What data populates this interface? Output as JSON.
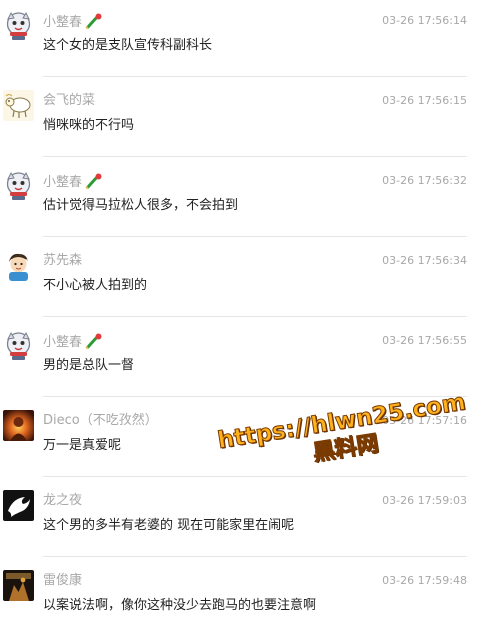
{
  "comments": [
    {
      "nick": "小整春",
      "has_badge": true,
      "avatar_icon": "cartoon-cat-avatar",
      "time": "03-26 17:56:14",
      "text": "这个女的是支队宣传科副科长"
    },
    {
      "nick": "会飞的菜",
      "has_badge": false,
      "avatar_icon": "sheep-doodle-avatar",
      "time": "03-26 17:56:15",
      "text": "悄咪咪的不行吗"
    },
    {
      "nick": "小整春",
      "has_badge": true,
      "avatar_icon": "cartoon-cat-avatar",
      "time": "03-26 17:56:32",
      "text": "估计觉得马拉松人很多，不会拍到"
    },
    {
      "nick": "苏先森",
      "has_badge": false,
      "avatar_icon": "cartoon-boy-avatar",
      "time": "03-26 17:56:34",
      "text": "不小心被人拍到的"
    },
    {
      "nick": "小整春",
      "has_badge": true,
      "avatar_icon": "cartoon-cat-avatar",
      "time": "03-26 17:56:55",
      "text": "男的是总队一督"
    },
    {
      "nick": "Dieco（不吃孜然）",
      "has_badge": false,
      "avatar_icon": "photo-avatar",
      "time": "03-26 17:57:16",
      "text": "万一是真爱呢"
    },
    {
      "nick": "龙之夜",
      "has_badge": false,
      "avatar_icon": "dragon-logo-avatar",
      "time": "03-26 17:59:03",
      "text": "这个男的多半有老婆的 现在可能家里在闹呢"
    },
    {
      "nick": "雷俊康",
      "has_badge": false,
      "avatar_icon": "poster-avatar",
      "time": "03-26 17:59:48",
      "text": "以案说法啊，像你这种没少去跑马的也要注意啊"
    }
  ],
  "watermark": {
    "line1": "https://hlwn25.com",
    "line2": "黑料网"
  },
  "colors": {
    "nick": "#a8a8a8",
    "time": "#a8a8a8",
    "text": "#222222",
    "divider": "#e6e6e6",
    "watermark": "#ffb21a"
  }
}
